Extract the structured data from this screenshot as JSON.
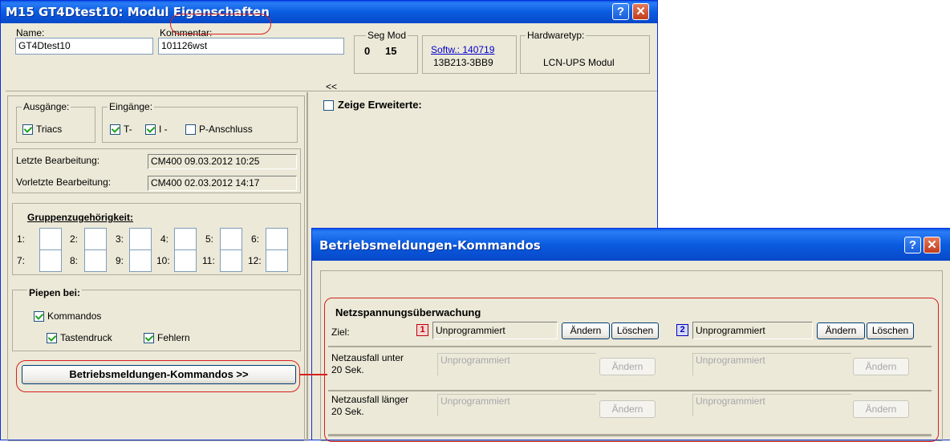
{
  "main_window": {
    "title_prefix": "M15 GT4Dtest10: Modul",
    "title_highlight": "Eigenschaften",
    "help_label": "?",
    "close_label": "✕",
    "name_label": "Name:",
    "name_value": "GT4Dtest10",
    "comment_label": "Kommentar:",
    "comment_value": "101126wst",
    "segmod_label": "Seg Mod",
    "seg_value": "0",
    "mod_value": "15",
    "software_link": "Softw.: 140719",
    "software_id": "13B213-3BB9",
    "hardware_label": "Hardwaretyp:",
    "hardware_value": "LCN-UPS Modul",
    "collapse_label": "<<",
    "outputs_legend": "Ausgänge:",
    "triacs_label": "Triacs",
    "inputs_legend": "Eingänge:",
    "t_label": "T-",
    "i_label": "I -",
    "p_label": "P-Anschluss",
    "last_edit_label": "Letzte Bearbeitung:",
    "last_edit_value": "CM400   09.03.2012 10:25",
    "prev_edit_label": "Vorletzte Bearbeitung:",
    "prev_edit_value": "CM400   02.03.2012 14:17",
    "groups_legend": "Gruppenzugehörigkeit:",
    "groups": [
      "1:",
      "2:",
      "3:",
      "4:",
      "5:",
      "6:",
      "7:",
      "8:",
      "9:",
      "10:",
      "11:",
      "12:"
    ],
    "beep_legend": "Piepen bei:",
    "beep_commands": "Kommandos",
    "beep_keypress": "Tastendruck",
    "beep_errors": "Fehlern",
    "operation_button": "Betriebsmeldungen-Kommandos >>",
    "show_extended": "Zeige Erweiterte:"
  },
  "dialog": {
    "title": "Betriebsmeldungen-Kommandos",
    "help_label": "?",
    "close_label": "✕",
    "section_title": "Netzspannungsüberwachung",
    "target_label": "Ziel:",
    "target1_badge": "1",
    "target1_value": "Unprogrammiert",
    "target2_badge": "2",
    "target2_value": "Unprogrammiert",
    "change_label": "Ändern",
    "delete_label": "Löschen",
    "rows": [
      {
        "label_line1": "Netzausfall unter",
        "label_line2": "20 Sek.",
        "value1": "Unprogrammiert",
        "value2": "Unprogrammiert"
      },
      {
        "label_line1": "Netzausfall länger",
        "label_line2": "20 Sek.",
        "value1": "Unprogrammiert",
        "value2": "Unprogrammiert"
      }
    ],
    "badge1_color": "#c00000",
    "badge2_color": "#0000c0"
  },
  "annotation_color": "#d62020"
}
